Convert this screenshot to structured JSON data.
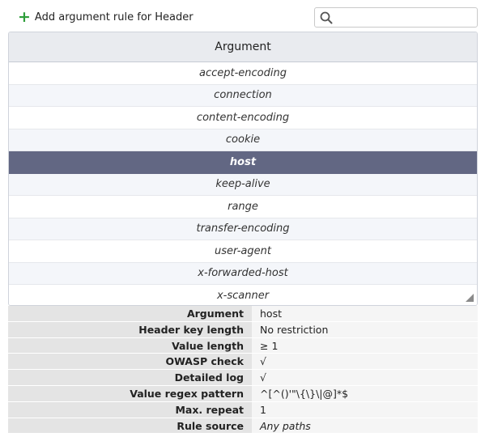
{
  "toolbar": {
    "add_label": "Add argument rule for Header",
    "search_value": "",
    "search_placeholder": ""
  },
  "table": {
    "header": "Argument",
    "rows": [
      "accept-encoding",
      "connection",
      "content-encoding",
      "cookie",
      "host",
      "keep-alive",
      "range",
      "transfer-encoding",
      "user-agent",
      "x-forwarded-host",
      "x-scanner"
    ],
    "selected": "host"
  },
  "details": [
    {
      "label": "Argument",
      "value": "host"
    },
    {
      "label": "Header key length",
      "value": "No restriction"
    },
    {
      "label": "Value length",
      "value": "≥ 1"
    },
    {
      "label": "OWASP check",
      "value": "√"
    },
    {
      "label": "Detailed log",
      "value": "√"
    },
    {
      "label": "Value regex pattern",
      "value": "^[^()'\"\\{\\}\\|@]*$"
    },
    {
      "label": "Max. repeat",
      "value": "1"
    },
    {
      "label": "Rule source",
      "value": "Any paths"
    }
  ],
  "colors": {
    "accent_green": "#2e9e3a",
    "selected_row": "#626783"
  },
  "icons": [
    "plus-icon",
    "search-icon",
    "resize-handle-icon"
  ]
}
